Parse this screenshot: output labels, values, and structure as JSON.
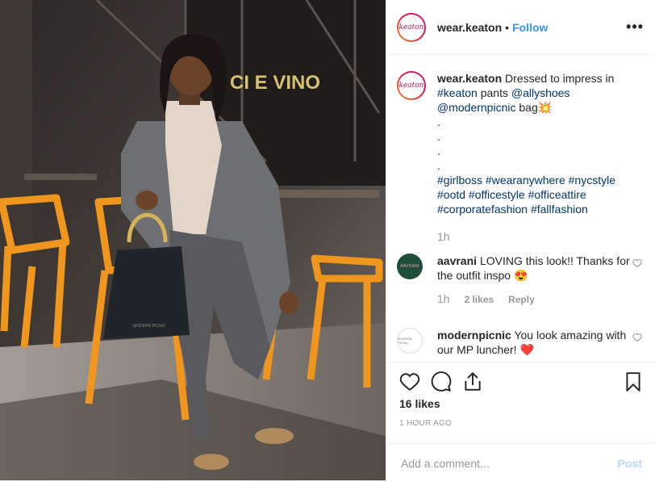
{
  "post": {
    "username": "wear.keaton",
    "follow_label": "Follow",
    "separator": "•",
    "more_label": "•••",
    "avatar_text": "keaton",
    "storefront_sign": "CI E VINO",
    "bag_brand": "MODERN PICNIC"
  },
  "caption": {
    "username": "wear.keaton",
    "text_1": "Dressed to impress in",
    "tag_keaton": "#keaton",
    "text_2": "pants",
    "mention_ally": "@allyshoes",
    "mention_mp": "@modernpicnic",
    "text_3": "bag💥",
    "dots": [
      ".",
      ".",
      ".",
      "."
    ],
    "hashtags_line1": "#girlboss #wearanywhere #nycstyle",
    "hashtags_line2": "#ootd #officestyle #officeattire",
    "hashtags_line3": "#corporatefashion #fallfashion",
    "age": "1h"
  },
  "comments": [
    {
      "username": "aavrani",
      "avatar_text": "AAVRANI",
      "text": "LOVING this look!! Thanks for the outfit inspo 😍",
      "age": "1h",
      "likes": "2 likes",
      "reply": "Reply"
    },
    {
      "username": "modernpicnic",
      "avatar_text": "MODERN PICNIC",
      "text": "You look amazing with our MP luncher! ❤️"
    }
  ],
  "actions": {
    "likes": "16 likes",
    "time": "1 HOUR AGO",
    "comment_placeholder": "Add a comment...",
    "post_label": "Post"
  },
  "colors": {
    "link": "#003569",
    "follow": "#3897f0",
    "muted": "#999999",
    "chairs": "#f0961e"
  }
}
